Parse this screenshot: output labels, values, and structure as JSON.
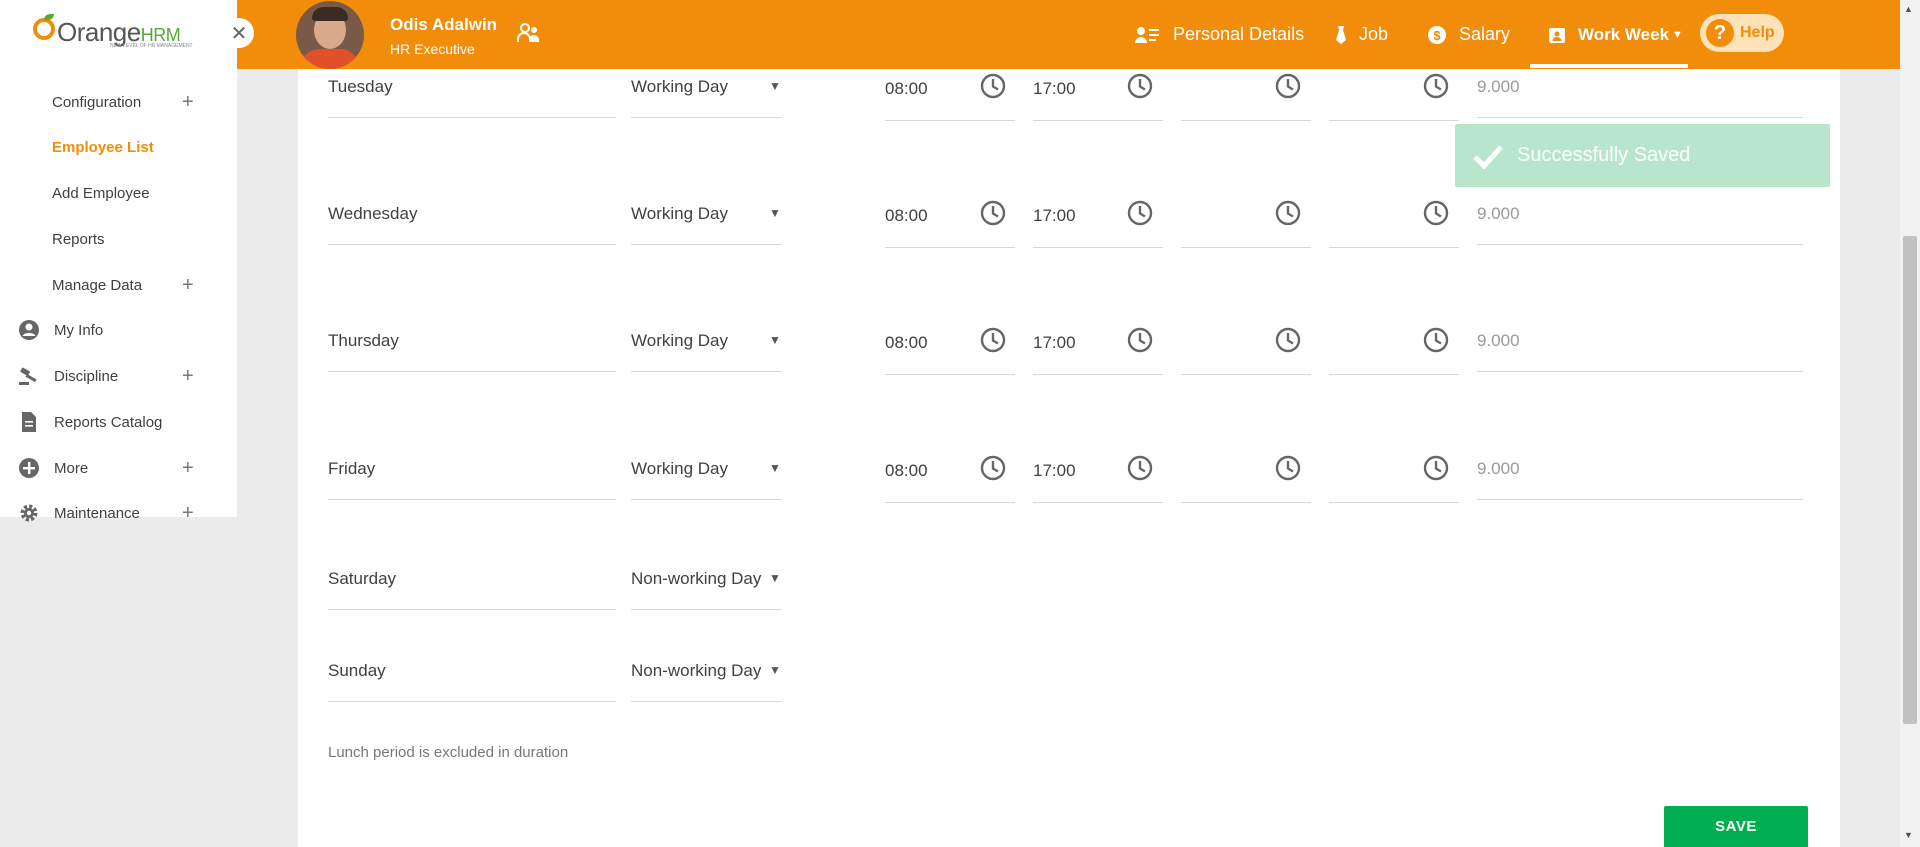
{
  "header": {
    "logo_text": "Orange",
    "logo_hrm": "HRM",
    "logo_tagline": "NEW LEVEL OF HR MANAGEMENT",
    "user_name": "Odis Adalwin",
    "user_role": "HR Executive",
    "nav": {
      "personal_details": "Personal Details",
      "job": "Job",
      "salary": "Salary",
      "work_week": "Work Week",
      "help": "Help"
    }
  },
  "sidebar": {
    "items": [
      {
        "label": "Configuration",
        "expandable": true
      },
      {
        "label": "Employee List",
        "active": true
      },
      {
        "label": "Add Employee"
      },
      {
        "label": "Reports"
      },
      {
        "label": "Manage Data",
        "expandable": true
      },
      {
        "label": "My Info",
        "icon": "person-circle-icon"
      },
      {
        "label": "Discipline",
        "icon": "gavel-icon",
        "expandable": true
      },
      {
        "label": "Reports Catalog",
        "icon": "document-icon"
      },
      {
        "label": "More",
        "icon": "plus-circle-icon",
        "expandable": true
      },
      {
        "label": "Maintenance",
        "icon": "gear-icon",
        "expandable": true
      }
    ]
  },
  "workweek": {
    "rows": [
      {
        "day": "Tuesday",
        "type": "Working Day",
        "start": "08:00",
        "end": "17:00",
        "duration": "9.000"
      },
      {
        "day": "Wednesday",
        "type": "Working Day",
        "start": "08:00",
        "end": "17:00",
        "duration": "9.000"
      },
      {
        "day": "Thursday",
        "type": "Working Day",
        "start": "08:00",
        "end": "17:00",
        "duration": "9.000"
      },
      {
        "day": "Friday",
        "type": "Working Day",
        "start": "08:00",
        "end": "17:00",
        "duration": "9.000"
      },
      {
        "day": "Saturday",
        "type": "Non-working Day"
      },
      {
        "day": "Sunday",
        "type": "Non-working Day"
      }
    ],
    "note": "Lunch period is excluded in duration",
    "save_label": "SAVE"
  },
  "toast": {
    "message": "Successfully Saved"
  },
  "colors": {
    "brand_orange": "#f28c0b",
    "save_green": "#00ad51",
    "toast_green": "#b8e6cc"
  }
}
